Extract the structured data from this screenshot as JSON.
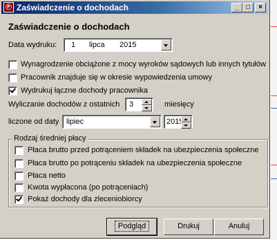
{
  "window": {
    "title": "Zaświadczenie o dochodach",
    "icon_text": "Ⓟ"
  },
  "controls": {
    "minimize": "_",
    "maximize": "□",
    "close": "×"
  },
  "heading": "Zaświadczenie o dochodach",
  "print_date": {
    "label": "Data wydruku:",
    "day": "1",
    "month": "lipca",
    "year": "2015"
  },
  "options": [
    {
      "label": "Wynagrodzenie obciążone z mocy wyroków sądowych lub innych tytułów",
      "checked": false
    },
    {
      "label": "Pracownik znajduje się w okresie wypowiedzenia umowy",
      "checked": false
    },
    {
      "label": "Wydrukuj łączne dochody pracownika",
      "checked": true
    }
  ],
  "income_period": {
    "label": "Wyliczanie dochodów z ostatnich",
    "value": "3",
    "unit": "miesięcy"
  },
  "count_from": {
    "label": "liczone od daty",
    "month": "lipiec",
    "year": "2015"
  },
  "group": {
    "title": "Rodzaj średniej płacy",
    "items": [
      {
        "label": "Płaca brutto przed potrąceniem składek na ubezpieczenia społeczne",
        "checked": false
      },
      {
        "label": "Płaca brutto po potrąceniu składek na ubezpieczenia społeczne",
        "checked": false
      },
      {
        "label": "Płaca netto",
        "checked": false
      },
      {
        "label": "Kwota wypłacona (po potrąceniach)",
        "checked": false
      },
      {
        "label": "Pokaż dochody dla zleceniobiorcy",
        "checked": true
      }
    ]
  },
  "buttons": {
    "preview": "Podgląd",
    "print": "Drukuj",
    "cancel": "Anuluj"
  },
  "colors": {
    "titlebar_start": "#0a246a",
    "titlebar_end": "#a6caf0",
    "face": "#d4d0c8"
  }
}
